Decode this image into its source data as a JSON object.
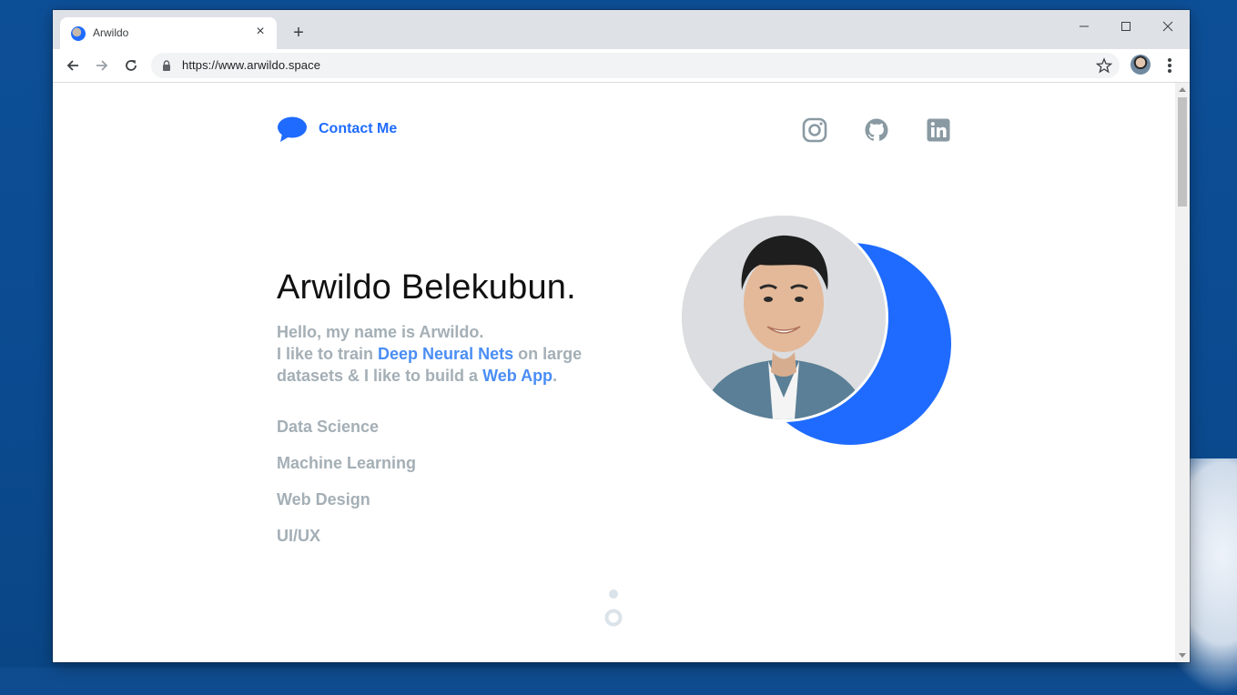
{
  "browser": {
    "tab": {
      "title": "Arwildo",
      "close_label": "×"
    },
    "new_tab_label": "+",
    "url": "https://www.arwildo.space"
  },
  "page": {
    "contact_label": "Contact Me",
    "name": "Arwildo Belekubun.",
    "intro": {
      "line1": "Hello, my name is Arwildo.",
      "line2_prefix": "I like to train ",
      "line2_highlight": "Deep Neural Nets",
      "line2_suffix": " on large",
      "line3_prefix": "datasets & I like to build a ",
      "line3_highlight": "Web App",
      "line3_suffix": "."
    },
    "skills": [
      "Data Science",
      "Machine Learning",
      "Web Design",
      "UI/UX"
    ],
    "social": [
      "instagram-icon",
      "github-icon",
      "linkedin-icon"
    ]
  },
  "colors": {
    "accent": "#1f6bff",
    "highlight": "#4a8df5",
    "muted_text": "#a4afb6",
    "icon_gray": "#8a9aa3"
  }
}
